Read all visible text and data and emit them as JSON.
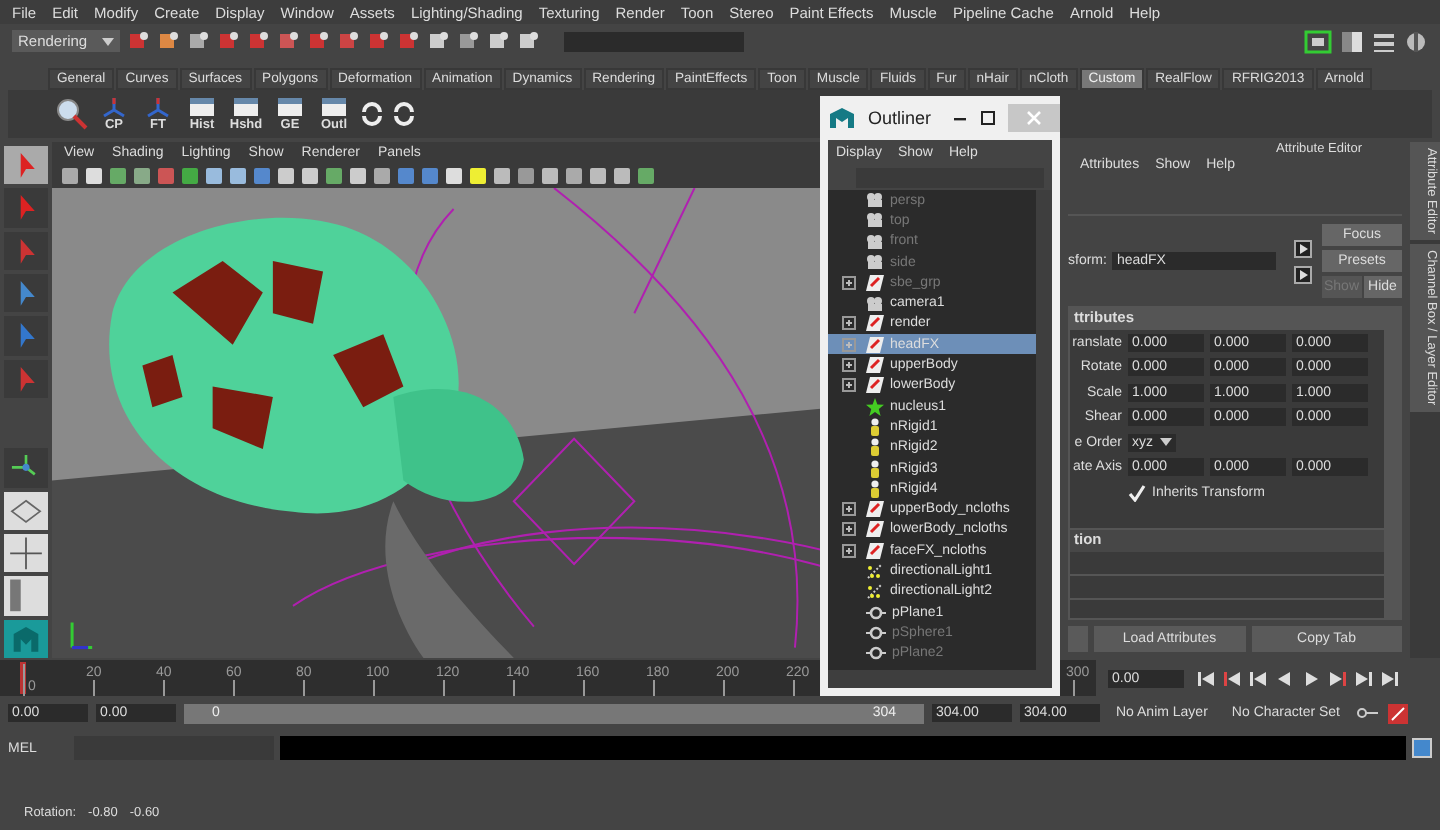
{
  "menu_bar": [
    "File",
    "Edit",
    "Modify",
    "Create",
    "Display",
    "Window",
    "Assets",
    "Lighting/Shading",
    "Texturing",
    "Render",
    "Toon",
    "Stereo",
    "Paint Effects",
    "Muscle",
    "Pipeline Cache",
    "Arnold",
    "Help"
  ],
  "toolbar": {
    "menu_set": "Rendering"
  },
  "shelf_tabs": [
    {
      "label": "General",
      "selected": false
    },
    {
      "label": "Curves",
      "selected": false
    },
    {
      "label": "Surfaces",
      "selected": false
    },
    {
      "label": "Polygons",
      "selected": false
    },
    {
      "label": "Deformation",
      "selected": false
    },
    {
      "label": "Animation",
      "selected": false
    },
    {
      "label": "Dynamics",
      "selected": false
    },
    {
      "label": "Rendering",
      "selected": false
    },
    {
      "label": "PaintEffects",
      "selected": false
    },
    {
      "label": "Toon",
      "selected": false
    },
    {
      "label": "Muscle",
      "selected": false
    },
    {
      "label": "Fluids",
      "selected": false
    },
    {
      "label": "Fur",
      "selected": false
    },
    {
      "label": "nHair",
      "selected": false
    },
    {
      "label": "nCloth",
      "selected": false
    },
    {
      "label": "Custom",
      "selected": true
    },
    {
      "label": "RealFlow",
      "selected": false
    },
    {
      "label": "RFRIG2013",
      "selected": false
    },
    {
      "label": "Arnold",
      "selected": false
    }
  ],
  "shelf_buttons": [
    "CP",
    "FT",
    "Hist",
    "Hshd",
    "GE",
    "Outl"
  ],
  "panel_menu": [
    "View",
    "Shading",
    "Lighting",
    "Show",
    "Renderer",
    "Panels"
  ],
  "outliner": {
    "title": "Outliner",
    "menu": [
      "Display",
      "Show",
      "Help"
    ],
    "items": [
      {
        "label": "persp",
        "kind": "camera",
        "dimmed": true,
        "expandable": false,
        "selected": false
      },
      {
        "label": "top",
        "kind": "camera",
        "dimmed": true,
        "expandable": false,
        "selected": false
      },
      {
        "label": "front",
        "kind": "camera",
        "dimmed": true,
        "expandable": false,
        "selected": false
      },
      {
        "label": "side",
        "kind": "camera",
        "dimmed": true,
        "expandable": false,
        "selected": false
      },
      {
        "label": "sbe_grp",
        "kind": "transform",
        "dimmed": true,
        "expandable": true,
        "selected": false
      },
      {
        "label": "camera1",
        "kind": "camera",
        "dimmed": false,
        "expandable": false,
        "selected": false
      },
      {
        "label": "render",
        "kind": "transform",
        "dimmed": false,
        "expandable": true,
        "selected": false
      },
      {
        "label": "headFX",
        "kind": "transform",
        "dimmed": false,
        "expandable": true,
        "selected": true
      },
      {
        "label": "upperBody",
        "kind": "transform",
        "dimmed": false,
        "expandable": true,
        "selected": false
      },
      {
        "label": "lowerBody",
        "kind": "transform",
        "dimmed": false,
        "expandable": true,
        "selected": false
      },
      {
        "label": "nucleus1",
        "kind": "nucleus",
        "dimmed": false,
        "expandable": false,
        "selected": false
      },
      {
        "label": "nRigid1",
        "kind": "rigid",
        "dimmed": false,
        "expandable": false,
        "selected": false
      },
      {
        "label": "nRigid2",
        "kind": "rigid",
        "dimmed": false,
        "expandable": false,
        "selected": false
      },
      {
        "label": "nRigid3",
        "kind": "rigid",
        "dimmed": false,
        "expandable": false,
        "selected": false
      },
      {
        "label": "nRigid4",
        "kind": "rigid",
        "dimmed": false,
        "expandable": false,
        "selected": false
      },
      {
        "label": "upperBody_ncloths",
        "kind": "transform",
        "dimmed": false,
        "expandable": true,
        "selected": false
      },
      {
        "label": "lowerBody_ncloths",
        "kind": "transform",
        "dimmed": false,
        "expandable": true,
        "selected": false
      },
      {
        "label": "faceFX_ncloths",
        "kind": "transform",
        "dimmed": false,
        "expandable": true,
        "selected": false
      },
      {
        "label": "directionalLight1",
        "kind": "light",
        "dimmed": false,
        "expandable": false,
        "selected": false
      },
      {
        "label": "directionalLight2",
        "kind": "light",
        "dimmed": false,
        "expandable": false,
        "selected": false
      },
      {
        "label": "pPlane1",
        "kind": "mesh",
        "dimmed": false,
        "expandable": false,
        "selected": false
      },
      {
        "label": "pSphere1",
        "kind": "mesh",
        "dimmed": true,
        "expandable": false,
        "selected": false
      },
      {
        "label": "pPlane2",
        "kind": "mesh",
        "dimmed": true,
        "expandable": false,
        "selected": false
      }
    ]
  },
  "attribute_editor": {
    "title": "Attribute Editor",
    "menu": [
      "Attributes",
      "Show",
      "Help"
    ],
    "transform_label": "sform:",
    "node_name": "headFX",
    "buttons": [
      {
        "label": "Focus",
        "disabled": false
      },
      {
        "label": "Presets",
        "disabled": false
      },
      {
        "label": "Show",
        "disabled": true
      },
      {
        "label": "Hide",
        "disabled": false
      }
    ],
    "section": "ttributes",
    "rows": [
      {
        "label": "ranslate",
        "kind": "vector",
        "values": [
          "0.000",
          "0.000",
          "0.000"
        ]
      },
      {
        "label": "Rotate",
        "kind": "vector",
        "values": [
          "0.000",
          "0.000",
          "0.000"
        ]
      },
      {
        "label": "Scale",
        "kind": "vector",
        "values": [
          "1.000",
          "1.000",
          "1.000"
        ]
      },
      {
        "label": "Shear",
        "kind": "vector",
        "values": [
          "0.000",
          "0.000",
          "0.000"
        ]
      },
      {
        "label": "e Order",
        "kind": "dropdown",
        "value": "xyz"
      },
      {
        "label": "ate Axis",
        "kind": "vector",
        "values": [
          "0.000",
          "0.000",
          "0.000"
        ]
      },
      {
        "label": "Inherits Transform",
        "kind": "checkbox",
        "checked": true
      }
    ],
    "section_2": "tion",
    "bottom_buttons": [
      "Load Attributes",
      "Copy Tab"
    ]
  },
  "side_tabs": [
    "Attribute Editor",
    "Channel Box / Layer Editor"
  ],
  "timeline": {
    "level": 0,
    "ticks": [
      "0",
      "20",
      "40",
      "60",
      "80",
      "100",
      "120",
      "140",
      "160",
      "180",
      "200",
      "220",
      "300"
    ],
    "current_frame": "0.00"
  },
  "range": {
    "level": 1,
    "start": "0.00",
    "playback_start": "0.00",
    "slider_start": "0",
    "slider_end": "304",
    "playback_end": "304.00",
    "end": "304.00",
    "anim_layer": "No Anim Layer",
    "character_set": "No Character Set"
  },
  "command_line": {
    "label": "MEL"
  },
  "help_line": {
    "label": "Rotation:",
    "values": [
      "-0.80",
      "-0.60"
    ]
  }
}
